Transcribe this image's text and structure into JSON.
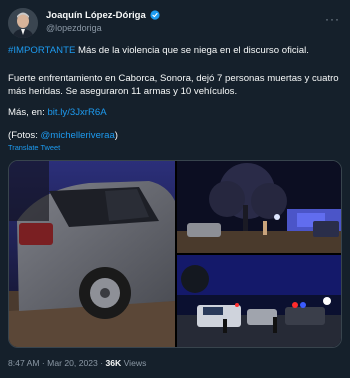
{
  "author": {
    "display_name": "Joaquín López-Dóriga",
    "handle": "@lopezdoriga",
    "verified_icon": "verified-badge-icon",
    "accent": "#1d9bf0"
  },
  "more_label": "···",
  "tweet": {
    "hashtag": "#IMPORTANTE",
    "line1_rest": " Más de la violencia que se niega en el discurso oficial.",
    "paragraph2": "Fuerte enfrentamiento en Caborca, Sonora, dejó 7 personas muertas y cuatro más heridas. Se aseguraron 11 armas y 10 vehículos.",
    "more_prefix": "Más, en: ",
    "more_link": "bit.ly/3JxrR6A",
    "photos_prefix": "(Fotos: ",
    "photos_mention": "@michelleriveraa",
    "photos_suffix": ")",
    "translate_label": "Translate Tweet"
  },
  "media": {
    "photos": [
      "photo-damaged-car",
      "photo-night-scene-tree",
      "photo-police-vehicles"
    ]
  },
  "meta": {
    "time": "8:47 AM",
    "separator": " · ",
    "date": "Mar 20, 2023",
    "views_count": "36K",
    "views_label": " Views"
  }
}
